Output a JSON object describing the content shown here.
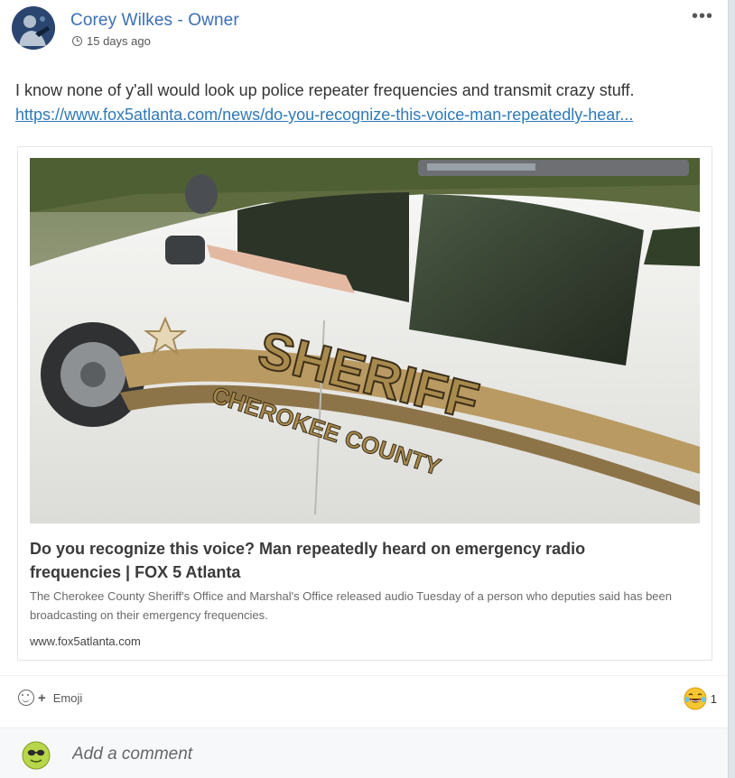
{
  "post": {
    "author": "Corey Wilkes - Owner",
    "time_ago": "15 days ago",
    "more_label": "•••",
    "text": "I know none of y'all would look up police repeater frequencies and transmit crazy stuff.",
    "link": "https://www.fox5atlanta.com/news/do-you-recognize-this-voice-man-repeatedly-hear..."
  },
  "preview": {
    "image_text_main": "SHERIFF",
    "image_text_sub": "CHEROKEE COUNTY",
    "title": "Do you recognize this voice? Man repeatedly heard on emergency radio frequencies | FOX 5 Atlanta",
    "description": "The Cherokee County Sheriff's Office and Marshal's Office released audio Tuesday of a person who deputies said has been broadcasting on their emergency frequencies.",
    "domain": "www.fox5atlanta.com"
  },
  "actions": {
    "emoji_plus": "+",
    "emoji_label": "Emoji",
    "reaction_icon": "laughing-emoji-icon",
    "reaction_count": "1"
  },
  "comment": {
    "placeholder": "Add a comment"
  },
  "colors": {
    "author": "#3b6fb6",
    "link": "#2f79b8",
    "badge_gold": "#b99a62"
  }
}
